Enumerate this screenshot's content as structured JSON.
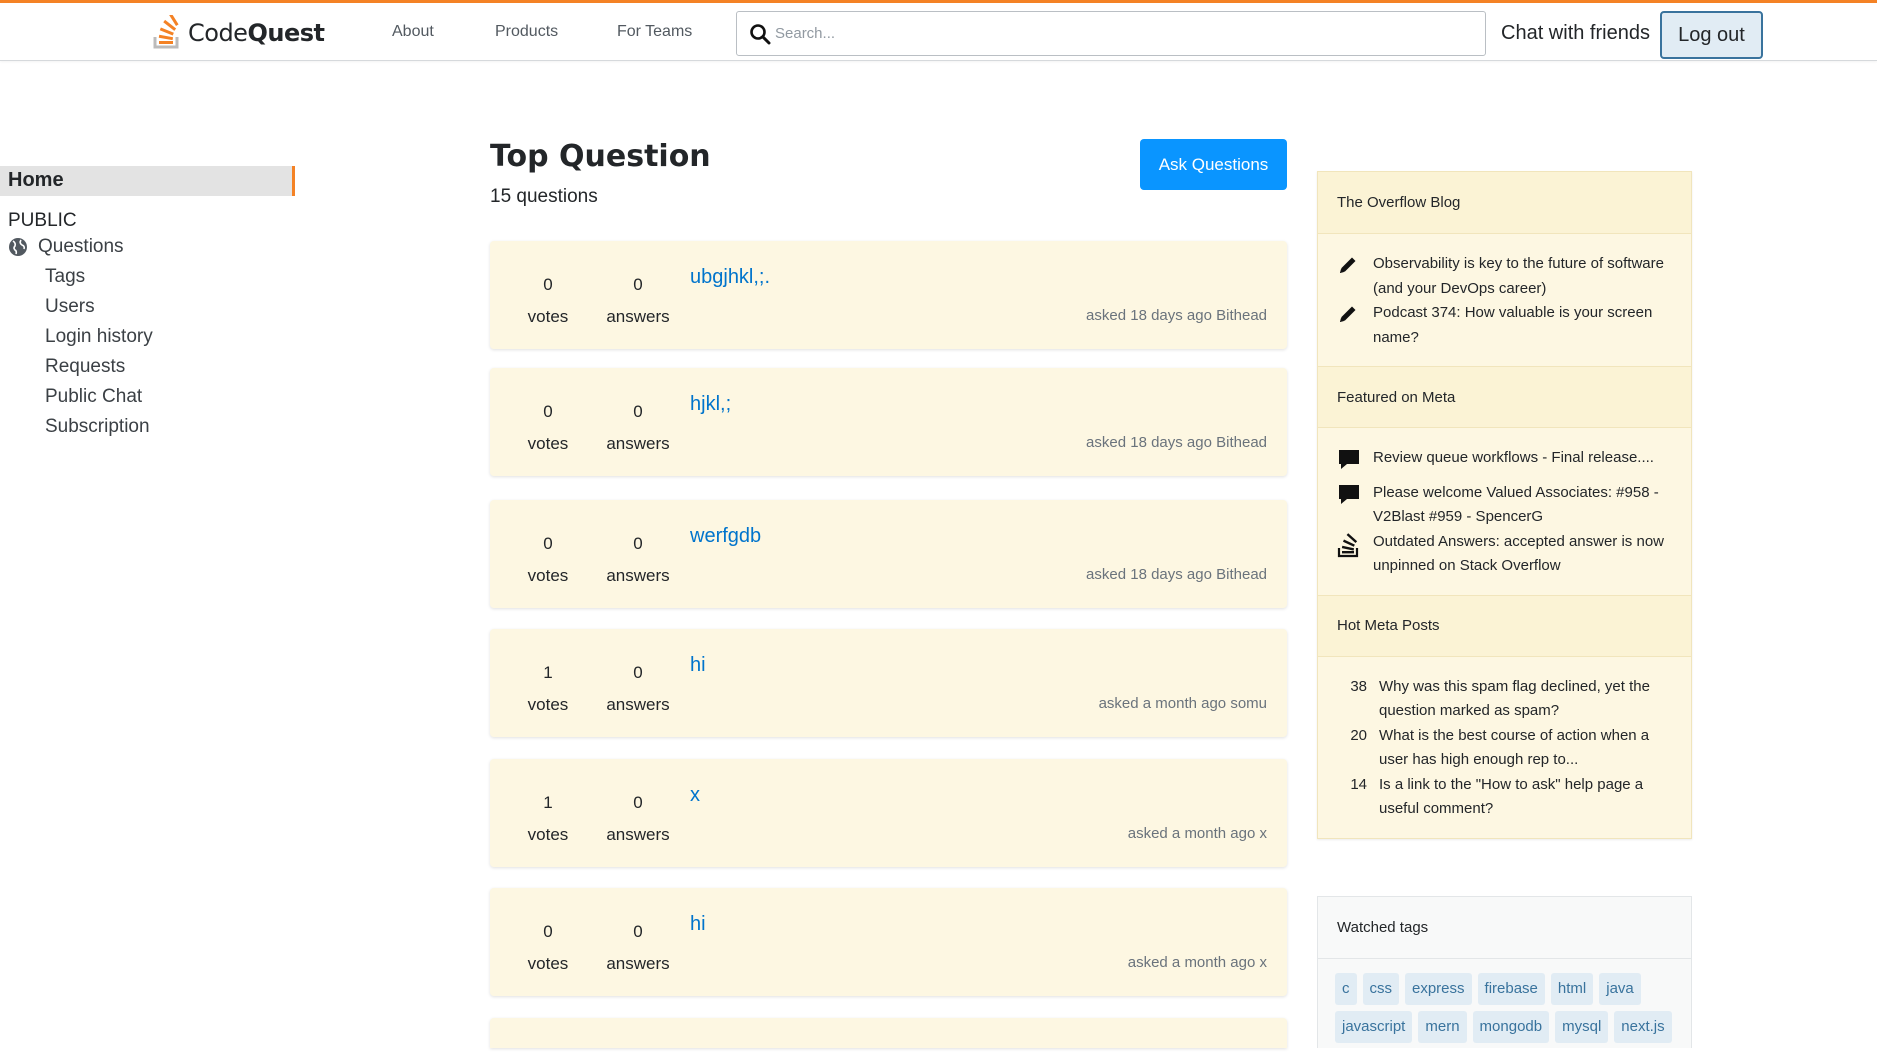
{
  "header": {
    "logo_brand": "Code",
    "logo_bold": "Quest",
    "nav": [
      "About",
      "Products",
      "For Teams"
    ],
    "search_placeholder": "Search...",
    "chat_label": "Chat with friends",
    "logout_label": "Log out",
    "accent_color": "#f48225"
  },
  "sidebar": {
    "home": "Home",
    "public": "PUBLIC",
    "questions": "Questions",
    "items": [
      "Tags",
      "Users",
      "Login history",
      "Requests",
      "Public Chat",
      "Subscription"
    ]
  },
  "main": {
    "title": "Top Question",
    "count": "15 questions",
    "ask_label": "Ask Questions",
    "questions": [
      {
        "votes": "0",
        "votes_label": "votes",
        "answers": "0",
        "answers_label": "answers",
        "title": "ubgjhkl,;.",
        "meta": "asked 18 days ago Bithead"
      },
      {
        "votes": "0",
        "votes_label": "votes",
        "answers": "0",
        "answers_label": "answers",
        "title": "hjkl,;",
        "meta": "asked 18 days ago Bithead"
      },
      {
        "votes": "0",
        "votes_label": "votes",
        "answers": "0",
        "answers_label": "answers",
        "title": "werfgdb",
        "meta": "asked 18 days ago Bithead"
      },
      {
        "votes": "1",
        "votes_label": "votes",
        "answers": "0",
        "answers_label": "answers",
        "title": "hi",
        "meta": "asked a month ago somu"
      },
      {
        "votes": "1",
        "votes_label": "votes",
        "answers": "0",
        "answers_label": "answers",
        "title": "x",
        "meta": "asked a month ago x"
      },
      {
        "votes": "0",
        "votes_label": "votes",
        "answers": "0",
        "answers_label": "answers",
        "title": "hi",
        "meta": "asked a month ago x"
      }
    ]
  },
  "widget": {
    "blog_head": "The Overflow Blog",
    "blog_items": [
      {
        "icon": "pencil-icon",
        "text": "Observability is key to the future of software (and your DevOps career)"
      },
      {
        "icon": "pencil-icon",
        "text": "Podcast 374: How valuable is your screen name?"
      }
    ],
    "meta_head": "Featured on Meta",
    "meta_items": [
      {
        "icon": "comment-icon",
        "text": "Review queue workflows - Final release...."
      },
      {
        "icon": "comment-icon",
        "text": "Please welcome Valued Associates: #958 - V2Blast #959 - SpencerG"
      },
      {
        "icon": "stack-icon",
        "text": "Outdated Answers: accepted answer is now unpinned on Stack Overflow"
      }
    ],
    "hot_head": "Hot Meta Posts",
    "hot_items": [
      {
        "count": "38",
        "text": "Why was this spam flag declined, yet the question marked as spam?"
      },
      {
        "count": "20",
        "text": "What is the best course of action when a user has high enough rep to..."
      },
      {
        "count": "14",
        "text": "Is a link to the \"How to ask\" help page a useful comment?"
      }
    ]
  },
  "tags": {
    "head": "Watched tags",
    "items": [
      "c",
      "css",
      "express",
      "firebase",
      "html",
      "java",
      "javascript",
      "mern",
      "mongodb",
      "mysql",
      "next.js"
    ]
  }
}
